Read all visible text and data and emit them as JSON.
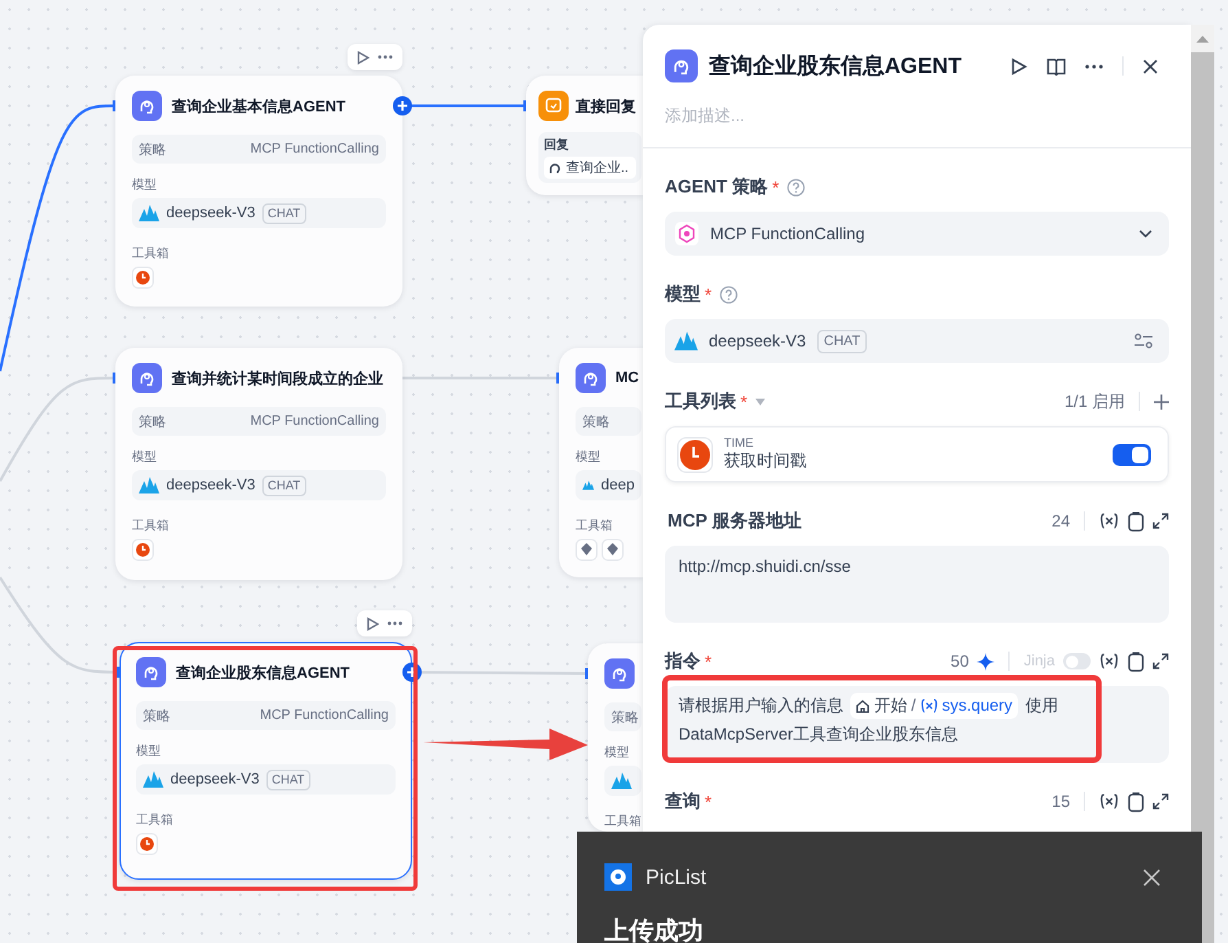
{
  "canvas": {
    "nodes": [
      {
        "kind": "agent",
        "title": "查询企业基本信息AGENT",
        "selected": false,
        "show_actions": true,
        "incoming_active": true,
        "strategy_label": "策略",
        "strategy": "MCP FunctionCalling",
        "model_label": "模型",
        "model": "deepseek-V3",
        "model_tag": "CHAT",
        "tools_label": "工具箱",
        "tools": [
          {
            "kind": "time"
          }
        ]
      },
      {
        "kind": "reply",
        "title": "直接回复",
        "selected": false,
        "show_actions": false,
        "incoming_active": true,
        "reply_label": "回复",
        "reply_ref": "查询企业.."
      },
      {
        "kind": "agent",
        "title": "查询并统计某时间段成立的企业",
        "selected": false,
        "show_actions": false,
        "incoming_active": false,
        "strategy_label": "策略",
        "strategy": "MCP FunctionCalling",
        "model_label": "模型",
        "model": "deepseek-V3",
        "model_tag": "CHAT",
        "tools_label": "工具箱",
        "tools": [
          {
            "kind": "time"
          }
        ]
      },
      {
        "kind": "agent",
        "title": "MC",
        "selected": false,
        "show_actions": false,
        "incoming_active": false,
        "strategy_label": "策略",
        "model_label": "模型",
        "model": "deep",
        "tools_label": "工具箱",
        "tools": [
          {
            "kind": "plugin"
          },
          {
            "kind": "plugin"
          }
        ]
      },
      {
        "kind": "agent",
        "title": "查询企业股东信息AGENT",
        "selected": true,
        "show_actions": true,
        "incoming_active": false,
        "strategy_label": "策略",
        "strategy": "MCP FunctionCalling",
        "model_label": "模型",
        "model": "deepseek-V3",
        "model_tag": "CHAT",
        "tools_label": "工具箱",
        "tools": [
          {
            "kind": "time"
          }
        ]
      },
      {
        "kind": "agent",
        "selected": false,
        "show_actions": false,
        "incoming_active": false,
        "strategy_label": "策略",
        "model_label": "模型",
        "tools_label": "工具箱"
      }
    ]
  },
  "panel": {
    "title": "查询企业股东信息AGENT",
    "description_placeholder": "添加描述...",
    "strategy": {
      "label": "AGENT 策略",
      "required": "*",
      "value": "MCP FunctionCalling"
    },
    "model": {
      "label": "模型",
      "required": "*",
      "value": "deepseek-V3",
      "tag": "CHAT"
    },
    "tools": {
      "label": "工具列表",
      "required": "*",
      "count": "1/1 启用",
      "items": [
        {
          "provider": "TIME",
          "name": "获取时间戳",
          "on": true
        }
      ]
    },
    "mcp_url": {
      "label": "MCP 服务器地址",
      "count": "24",
      "value": "http://mcp.shuidi.cn/sse"
    },
    "instruction": {
      "label": "指令",
      "required": "*",
      "count": "50",
      "jinja_label": "Jinja",
      "jinja_on": false,
      "text_before": "请根据用户输入的信息",
      "var_node": "开始",
      "separator": "/",
      "var_name": "sys.query",
      "text_after": "使用",
      "text_line2": "DataMcpServer工具查询企业股东信息"
    },
    "query": {
      "label": "查询",
      "required": "*",
      "count": "15"
    }
  },
  "toast": {
    "app": "PicList",
    "title": "上传成功"
  }
}
